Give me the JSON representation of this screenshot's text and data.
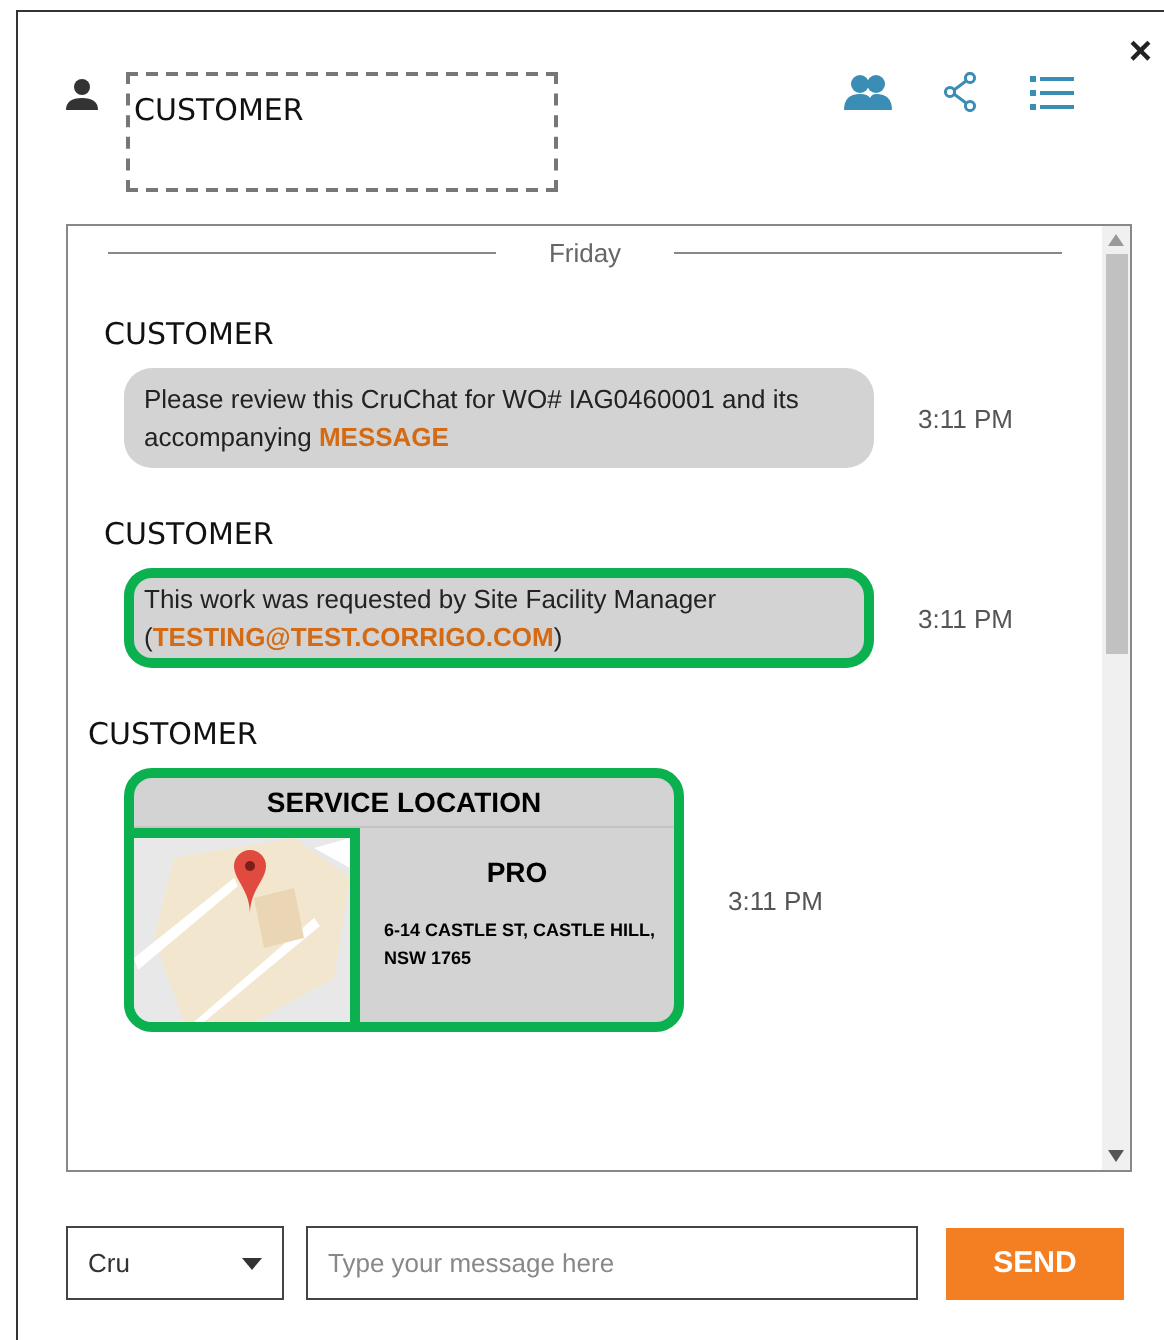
{
  "header": {
    "name": "CUSTOMER",
    "close": "×"
  },
  "day_divider": "Friday",
  "messages": [
    {
      "kind": "text",
      "sender": "CUSTOMER",
      "text": "Please review this CruChat for WO# IAG0460001 and its accompanying **MESSAGE**",
      "time": "3:11 PM",
      "highlighted": false
    },
    {
      "kind": "text",
      "sender": "CUSTOMER",
      "text": "This work was requested by Site Facility Manager (**TESTING@TEST.CORRIGO.COM**)",
      "time": "3:11 PM",
      "highlighted": true
    },
    {
      "kind": "location",
      "sender": "CUSTOMER",
      "title": "SERVICE LOCATION",
      "place": "PRO",
      "address": "6-14 CASTLE ST, CASTLE HILL, NSW 1765",
      "time": "3:11 PM",
      "highlighted": true
    }
  ],
  "composer": {
    "channel": "Cru",
    "placeholder": "Type your message here",
    "send": "SEND"
  }
}
